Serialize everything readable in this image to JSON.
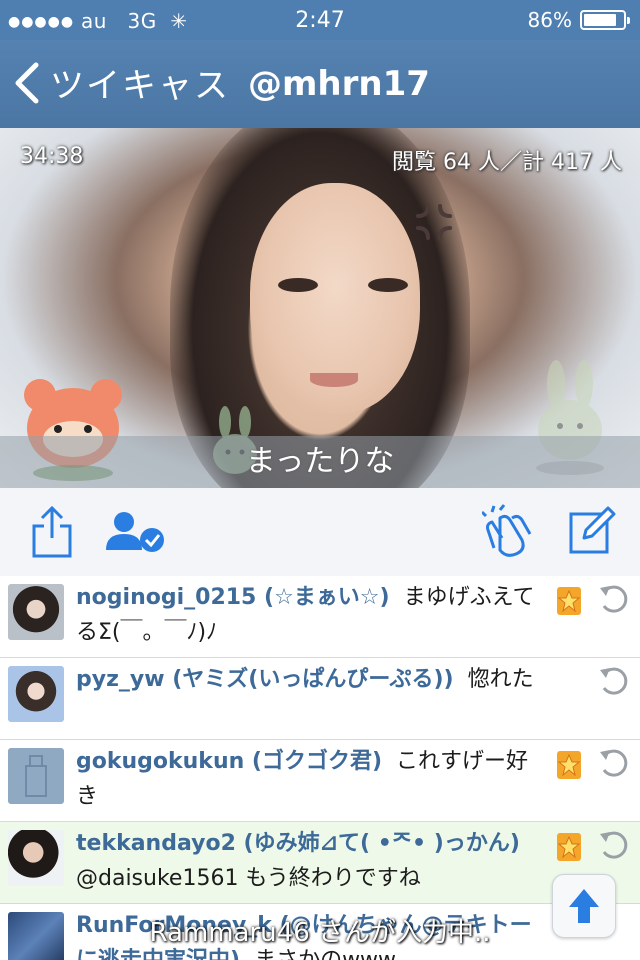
{
  "status_bar": {
    "signal_dots": "●●●●●",
    "carrier": "au",
    "network": "3G",
    "loading_glyph": "✳",
    "time": "2:47",
    "battery": "86%",
    "battery_level": 0.86
  },
  "nav": {
    "back_label": "ツイキャス",
    "title": "@mhrn17"
  },
  "video": {
    "elapsed": "34:38",
    "viewers": "閲覧 64 人／計 417 人",
    "caption": "まったりな"
  },
  "toolbar": {
    "icons": [
      "share-icon",
      "follow-user-icon",
      "clap-icon",
      "compose-icon"
    ]
  },
  "comments": [
    {
      "user": "noginogi_0215 (☆まぁい☆)",
      "text": "まゆげふえてるΣ(￣。￣ﾉ)ﾉ",
      "badge": true,
      "highlight": false
    },
    {
      "user": "pyz_yw (ヤミズ(いっぱんぴーぷる))",
      "text": "惚れた",
      "badge": false,
      "highlight": false
    },
    {
      "user": "gokugokukun (ゴクゴク君)",
      "text": "これすげー好き",
      "badge": true,
      "highlight": false
    },
    {
      "user": "tekkandayo2 (ゆみ姉⊿て( •ᄌ• )っかん)",
      "text": "@daisuke1561 もう終わりですね",
      "badge": true,
      "highlight": true
    },
    {
      "user": "RunForMoney_k (@けんちゃん@テキトーに逃走中実況中)",
      "text": "まさかのwww",
      "badge": false,
      "highlight": false
    }
  ],
  "toast": "Rammaru46 さんが入力中..",
  "colors": {
    "nav": "#4f7fb0",
    "accent": "#2a7de1",
    "username": "#3d6a98",
    "highlight_row": "#eef9e9"
  }
}
